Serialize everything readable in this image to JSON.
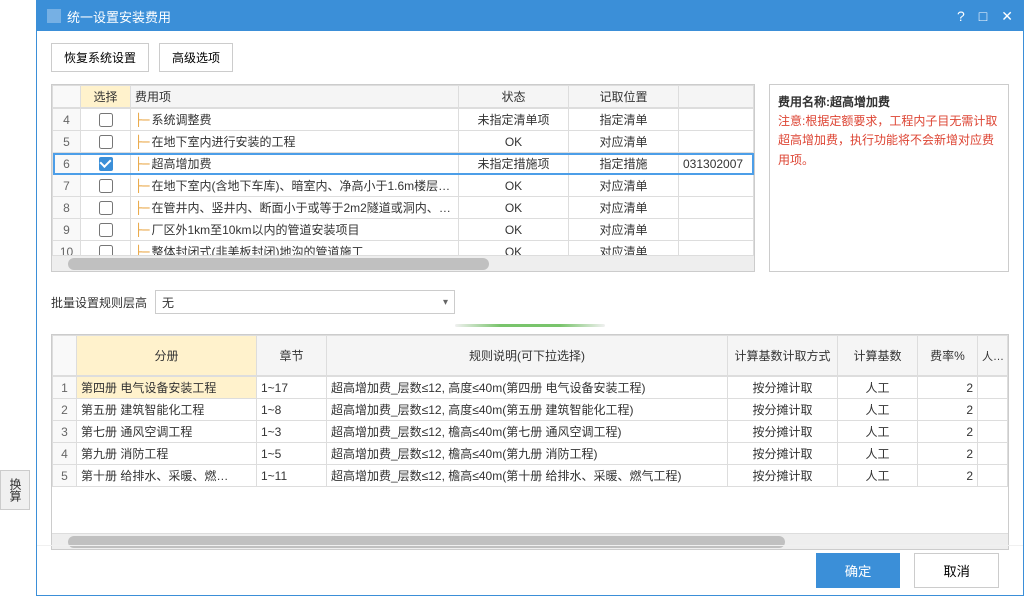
{
  "side_button": "换算",
  "dialog": {
    "title": "统一设置安装费用",
    "controls": {
      "help": "?",
      "max": "□",
      "close": "✕"
    }
  },
  "toolbar": {
    "restore": "恢复系统设置",
    "advanced": "高级选项"
  },
  "info_panel": {
    "name_label": "费用名称:",
    "name_value": "超高增加费",
    "note": "注意:根据定额要求，工程内子目无需计取超高增加费，执行功能将不会新增对应费用项。"
  },
  "upper_grid": {
    "headers": {
      "select": "选择",
      "item": "费用项",
      "status": "状态",
      "location": "记取位置",
      "code": ""
    },
    "rows": [
      {
        "n": "4",
        "checked": false,
        "item": "系统调整费",
        "status": "未指定清单项",
        "loc": "指定清单",
        "code": ""
      },
      {
        "n": "5",
        "checked": false,
        "item": "在地下室内进行安装的工程",
        "status": "OK",
        "loc": "对应清单",
        "code": ""
      },
      {
        "n": "6",
        "checked": true,
        "item": "超高增加费",
        "status": "未指定措施项",
        "loc": "指定措施",
        "code": "031302007"
      },
      {
        "n": "7",
        "checked": false,
        "item": "在地下室内(含地下车库)、暗室内、净高小于1.6m楼层、…",
        "status": "OK",
        "loc": "对应清单",
        "code": ""
      },
      {
        "n": "8",
        "checked": false,
        "item": "在管井内、竖井内、断面小于或等于2m2隧道或洞内、封…",
        "status": "OK",
        "loc": "对应清单",
        "code": ""
      },
      {
        "n": "9",
        "checked": false,
        "item": "厂区外1km至10km以内的管道安装项目",
        "status": "OK",
        "loc": "对应清单",
        "code": ""
      },
      {
        "n": "10",
        "checked": false,
        "item": "整体封闭式(非美板封闭)地沟的管道施工",
        "status": "OK",
        "loc": "对应清单",
        "code": ""
      }
    ]
  },
  "batch": {
    "label": "批量设置规则层高",
    "value": "无"
  },
  "lower_grid": {
    "headers": {
      "book": "分册",
      "chapter": "章节",
      "rule": "规则说明(可下拉选择)",
      "method": "计算基数计取方式",
      "base": "计算基数",
      "rate": "费率%",
      "labor": "人工"
    },
    "rows": [
      {
        "n": "1",
        "book": "第四册  电气设备安装工程",
        "chap": "1~17",
        "rule": "超高增加费_层数≤12, 高度≤40m(第四册  电气设备安装工程)",
        "method": "按分摊计取",
        "base": "人工",
        "rate": "2"
      },
      {
        "n": "2",
        "book": "第五册  建筑智能化工程",
        "chap": "1~8",
        "rule": "超高增加费_层数≤12, 高度≤40m(第五册  建筑智能化工程)",
        "method": "按分摊计取",
        "base": "人工",
        "rate": "2"
      },
      {
        "n": "3",
        "book": "第七册  通风空调工程",
        "chap": "1~3",
        "rule": "超高增加费_层数≤12, 檐高≤40m(第七册  通风空调工程)",
        "method": "按分摊计取",
        "base": "人工",
        "rate": "2"
      },
      {
        "n": "4",
        "book": "第九册  消防工程",
        "chap": "1~5",
        "rule": "超高增加费_层数≤12, 檐高≤40m(第九册  消防工程)",
        "method": "按分摊计取",
        "base": "人工",
        "rate": "2"
      },
      {
        "n": "5",
        "book": "第十册  给排水、采暖、燃…",
        "chap": "1~11",
        "rule": "超高增加费_层数≤12, 檐高≤40m(第十册  给排水、采暖、燃气工程)",
        "method": "按分摊计取",
        "base": "人工",
        "rate": "2"
      }
    ]
  },
  "footer": {
    "ok": "确定",
    "cancel": "取消"
  }
}
